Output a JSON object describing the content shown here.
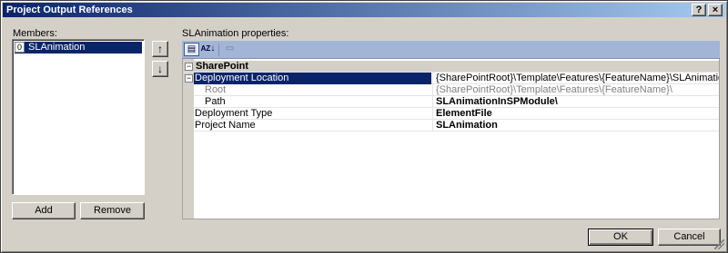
{
  "window": {
    "title": "Project Output References",
    "help_glyph": "?",
    "close_glyph": "×"
  },
  "members": {
    "label": "Members:",
    "items": [
      {
        "index": "0",
        "name": "SLAnimation"
      }
    ],
    "move_up_glyph": "↑",
    "move_down_glyph": "↓",
    "add_label": "Add",
    "remove_label": "Remove"
  },
  "properties": {
    "label": "SLAnimation properties:",
    "toolbar_icons": [
      "categorized-icon",
      "alphabetical-icon",
      "property-pages-icon"
    ],
    "toolbar_glyphs": {
      "categorized": "▤",
      "alphabetical": "↓",
      "pages": "▭"
    },
    "category": {
      "expander": "−",
      "name": "SharePoint"
    },
    "rows": [
      {
        "expander": "−",
        "name": "Deployment Location",
        "value": "{SharePointRoot}\\Template\\Features\\{FeatureName}\\SLAnimationInSPModule\\"
      },
      {
        "name": "Root",
        "value": "{SharePointRoot}\\Template\\Features\\{FeatureName}\\"
      },
      {
        "name": "Path",
        "value": "SLAnimationInSPModule\\"
      },
      {
        "name": "Deployment Type",
        "value": "ElementFile"
      },
      {
        "name": "Project Name",
        "value": "SLAnimation"
      }
    ]
  },
  "footer": {
    "ok_label": "OK",
    "cancel_label": "Cancel"
  },
  "colors": {
    "title_start": "#0a246a",
    "title_end": "#a6caf0",
    "selection": "#0a246a",
    "toolbar": "#a3b5d6",
    "face": "#d4d0c8"
  }
}
